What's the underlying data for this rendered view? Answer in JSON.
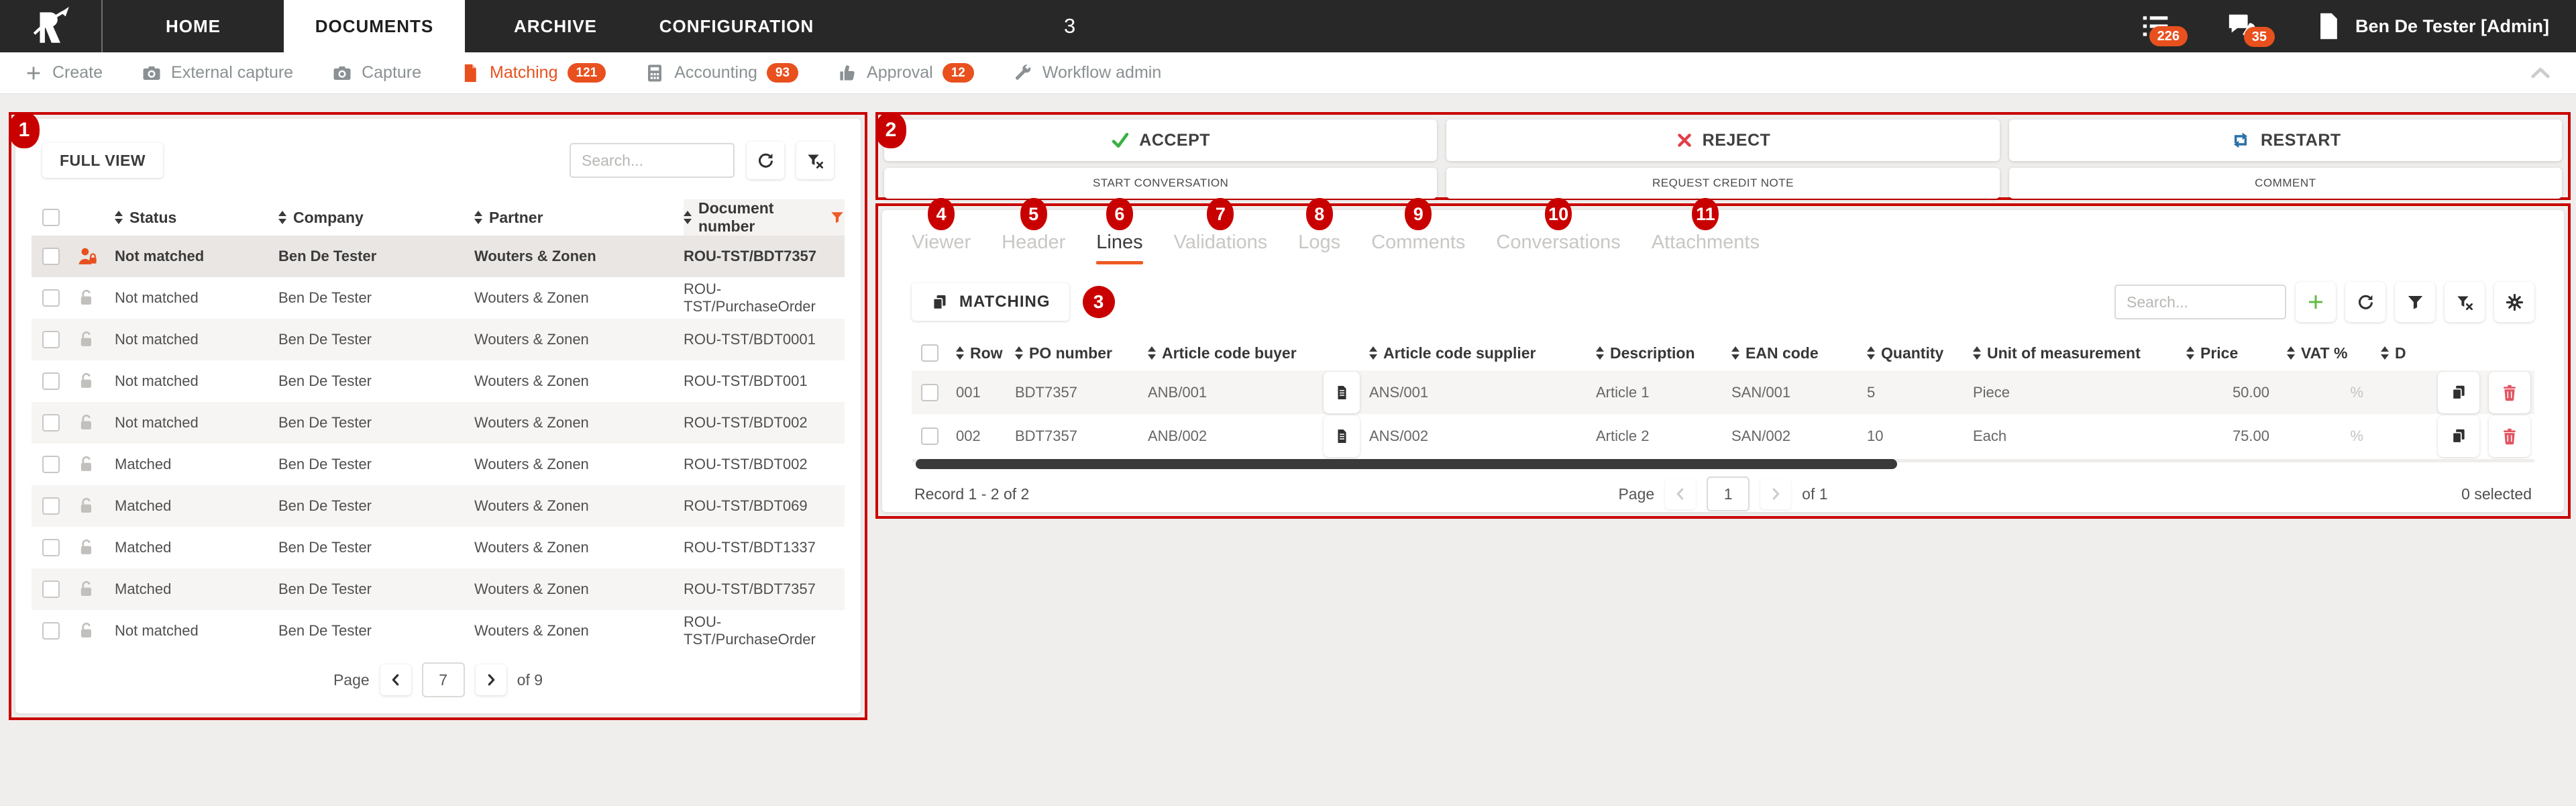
{
  "colors": {
    "accent_orange": "#e8501e",
    "annotation_red": "#c90000",
    "accept_green": "#3cb043",
    "reject_red": "#e0404a",
    "restart_blue": "#2a70a8",
    "delete_red": "#e25563",
    "add_green": "#62bb46"
  },
  "marks": [
    "1",
    "2",
    "3",
    "4",
    "5",
    "6",
    "7",
    "8",
    "9",
    "10",
    "11"
  ],
  "navbar": {
    "tabs": [
      "HOME",
      "DOCUMENTS",
      "ARCHIVE",
      "CONFIGURATION"
    ],
    "center_marker": "3",
    "tasks_badge": "226",
    "messages_badge": "35",
    "user_name": "Ben De Tester [Admin]"
  },
  "toolbar": {
    "create": "Create",
    "external_capture": "External capture",
    "capture": "Capture",
    "matching": "Matching",
    "matching_badge": "121",
    "accounting": "Accounting",
    "accounting_badge": "93",
    "approval": "Approval",
    "approval_badge": "12",
    "workflow_admin": "Workflow admin"
  },
  "left_panel": {
    "full_view": "FULL VIEW",
    "search_placeholder": "Search...",
    "columns": {
      "status": "Status",
      "company": "Company",
      "partner": "Partner",
      "document": "Document number"
    },
    "rows": [
      {
        "status": "Not matched",
        "company": "Ben De Tester",
        "partner": "Wouters & Zonen",
        "document": "ROU-TST/BDT7357"
      },
      {
        "status": "Not matched",
        "company": "Ben De Tester",
        "partner": "Wouters & Zonen",
        "document": "ROU-TST/PurchaseOrder"
      },
      {
        "status": "Not matched",
        "company": "Ben De Tester",
        "partner": "Wouters & Zonen",
        "document": "ROU-TST/BDT0001"
      },
      {
        "status": "Not matched",
        "company": "Ben De Tester",
        "partner": "Wouters & Zonen",
        "document": "ROU-TST/BDT001"
      },
      {
        "status": "Not matched",
        "company": "Ben De Tester",
        "partner": "Wouters & Zonen",
        "document": "ROU-TST/BDT002"
      },
      {
        "status": "Matched",
        "company": "Ben De Tester",
        "partner": "Wouters & Zonen",
        "document": "ROU-TST/BDT002"
      },
      {
        "status": "Matched",
        "company": "Ben De Tester",
        "partner": "Wouters & Zonen",
        "document": "ROU-TST/BDT069"
      },
      {
        "status": "Matched",
        "company": "Ben De Tester",
        "partner": "Wouters & Zonen",
        "document": "ROU-TST/BDT1337"
      },
      {
        "status": "Matched",
        "company": "Ben De Tester",
        "partner": "Wouters & Zonen",
        "document": "ROU-TST/BDT7357"
      },
      {
        "status": "Not matched",
        "company": "Ben De Tester",
        "partner": "Wouters & Zonen",
        "document": "ROU-TST/PurchaseOrder"
      }
    ],
    "pagination": {
      "label": "Page",
      "value": "7",
      "of": "of 9"
    }
  },
  "actions": {
    "accept": "ACCEPT",
    "reject": "REJECT",
    "restart": "RESTART",
    "start_conversation": "START CONVERSATION",
    "request_credit_note": "REQUEST CREDIT NOTE",
    "comment": "COMMENT"
  },
  "detail": {
    "tabs": [
      "Viewer",
      "Header",
      "Lines",
      "Validations",
      "Logs",
      "Comments",
      "Conversations",
      "Attachments"
    ],
    "active_tab": "Lines",
    "matching_button": "MATCHING",
    "search_placeholder": "Search...",
    "columns": {
      "row": "Row",
      "po": "PO number",
      "buyer": "Article code buyer",
      "supplier": "Article code supplier",
      "description": "Description",
      "ean": "EAN code",
      "quantity": "Quantity",
      "uom": "Unit of measurement",
      "price": "Price",
      "vat": "VAT %",
      "d": "D"
    },
    "rows": [
      {
        "row": "001",
        "po": "BDT7357",
        "buyer": "ANB/001",
        "supplier": "ANS/001",
        "description": "Article 1",
        "ean": "SAN/001",
        "quantity": "5",
        "uom": "Piece",
        "price": "50.00",
        "vat": "%"
      },
      {
        "row": "002",
        "po": "BDT7357",
        "buyer": "ANB/002",
        "supplier": "ANS/002",
        "description": "Article 2",
        "ean": "SAN/002",
        "quantity": "10",
        "uom": "Each",
        "price": "75.00",
        "vat": "%"
      }
    ],
    "footer": {
      "record": "Record 1 - 2 of 2",
      "page_label": "Page",
      "page_value": "1",
      "page_of": "of 1",
      "selected": "0 selected"
    }
  }
}
